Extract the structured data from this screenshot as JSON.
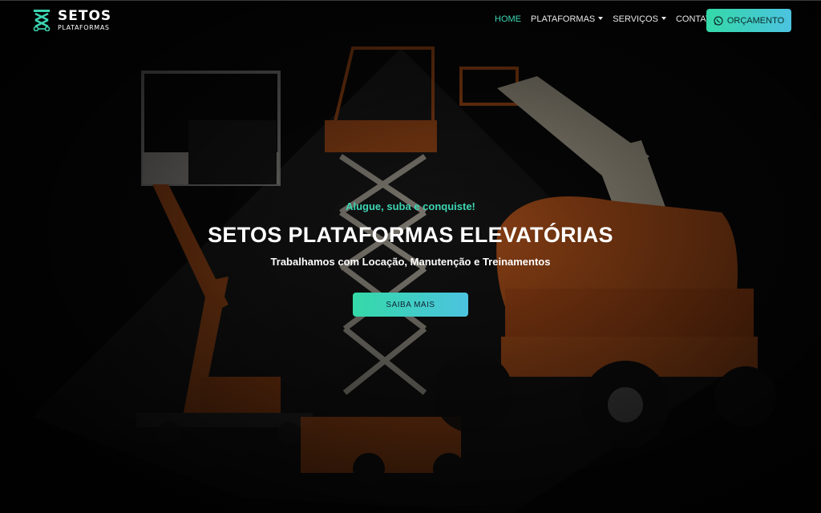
{
  "brand": {
    "title": "SETOS",
    "subtitle": "PLATAFORMAS"
  },
  "nav": {
    "items": [
      {
        "label": "HOME",
        "active": true,
        "dropdown": false
      },
      {
        "label": "PLATAFORMAS",
        "active": false,
        "dropdown": true
      },
      {
        "label": "SERVIÇOS",
        "active": false,
        "dropdown": true
      },
      {
        "label": "CONTATO",
        "active": false,
        "dropdown": false
      }
    ],
    "cta_label": "ORÇAMENTO",
    "cta_icon": "whatsapp-icon"
  },
  "hero": {
    "tagline": "Alugue, suba e conquiste!",
    "headline": "SETOS PLATAFORMAS ELEVATÓRIAS",
    "subline": "Trabalhamos com Locação, Manutenção e Treinamentos",
    "button_label": "SAIBA MAIS",
    "background": "aerial work platforms (JLG lifts) photo"
  },
  "colors": {
    "accent": "#3dd6b3",
    "accent_end": "#4cc3e0",
    "background": "#0b0b0b",
    "machine_orange": "#e8641c"
  }
}
